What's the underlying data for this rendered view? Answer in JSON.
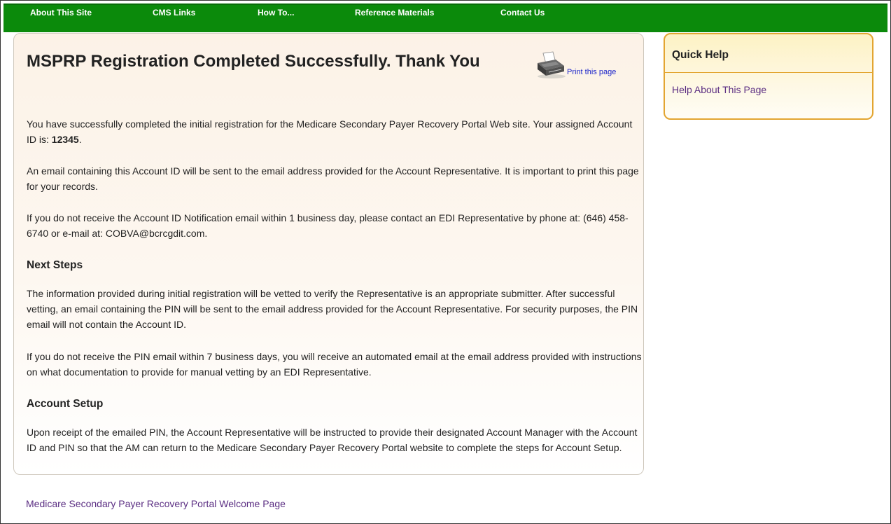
{
  "nav": {
    "items": [
      {
        "label": "About This Site"
      },
      {
        "label": "CMS Links"
      },
      {
        "label": "How To..."
      },
      {
        "label": "Reference Materials"
      },
      {
        "label": "Contact Us"
      }
    ]
  },
  "main": {
    "title": "MSPRP Registration Completed Successfully. Thank You",
    "print_link": "Print this page",
    "intro": {
      "before": "You have successfully completed the initial registration for the Medicare Secondary Payer Recovery Portal Web site. Your assigned Account ID is: ",
      "account_id": "12345",
      "after": "."
    },
    "p_email": "An email containing this Account ID will be sent to the email address provided for the Account Representative. It is important to print this page for your records.",
    "p_contact": "If you do not receive the Account ID Notification email within 1 business day, please contact an EDI Representative by phone at: (646) 458-6740 or e-mail at: COBVA@bcrcgdit.com.",
    "next_steps_heading": "Next Steps",
    "p_vetting": "The information provided during initial registration will be vetted to verify the Representative is an appropriate submitter. After successful vetting, an email containing the PIN will be sent to the email address provided for the Account Representative. For security purposes, the PIN email will not contain the Account ID.",
    "p_pin": "If you do not receive the PIN email within 7 business days, you will receive an automated email at the email address provided with instructions on what documentation to provide for manual vetting by an EDI Representative.",
    "account_setup_heading": "Account Setup",
    "p_setup": "Upon receipt of the emailed PIN, the Account Representative will be instructed to provide their designated Account Manager with the Account ID and PIN so that the AM can return to the Medicare Secondary Payer Recovery Portal website to complete the steps for Account Setup."
  },
  "quick_help": {
    "title": "Quick Help",
    "link": "Help About This Page"
  },
  "footer": {
    "welcome_link": "Medicare Secondary Payer Recovery Portal Welcome Page"
  },
  "icons": {
    "print": "printer-icon"
  },
  "colors": {
    "nav_bg": "#0b8a0b",
    "quick_help_border": "#e3a531",
    "link": "#5a2d82"
  }
}
